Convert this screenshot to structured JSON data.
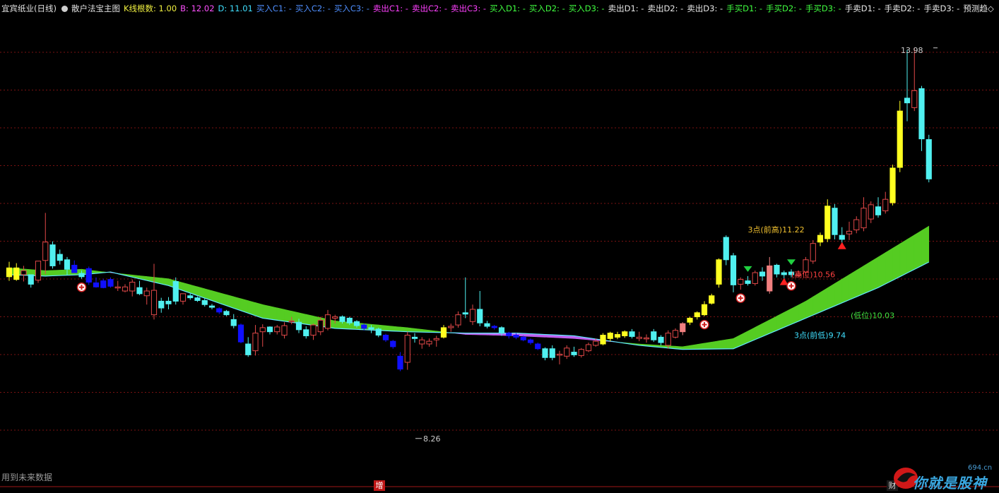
{
  "header": {
    "stock_title": "宜宾纸业(日线)",
    "indicator_name": "散户法宝主图",
    "items": [
      {
        "label": "K线根数: 1.00",
        "color": "#f0f040"
      },
      {
        "label": "B: 12.02",
        "color": "#ff50ff"
      },
      {
        "label": "D: 11.01",
        "color": "#40e0ff"
      },
      {
        "label": "买入C1: -",
        "color": "#4f8fff"
      },
      {
        "label": "买入C2: -",
        "color": "#4f8fff"
      },
      {
        "label": "买入C3: -",
        "color": "#4f8fff"
      },
      {
        "label": "卖出C1: -",
        "color": "#ff40ff"
      },
      {
        "label": "卖出C2: -",
        "color": "#ff40ff"
      },
      {
        "label": "卖出C3: -",
        "color": "#ff40ff"
      },
      {
        "label": "买入D1: -",
        "color": "#40ff40"
      },
      {
        "label": "买入D2: -",
        "color": "#40ff40"
      },
      {
        "label": "买入D3: -",
        "color": "#40ff40"
      },
      {
        "label": "卖出D1: -",
        "color": "#e8e8e8"
      },
      {
        "label": "卖出D2: -",
        "color": "#e8e8e8"
      },
      {
        "label": "卖出D3: -",
        "color": "#e8e8e8"
      },
      {
        "label": "手买D1: -",
        "color": "#40ff40"
      },
      {
        "label": "手买D2: -",
        "color": "#40ff40"
      },
      {
        "label": "手买D3: -",
        "color": "#40ff40"
      },
      {
        "label": "手卖D1: -",
        "color": "#e8e8e8"
      },
      {
        "label": "手卖D2: -",
        "color": "#e8e8e8"
      },
      {
        "label": "手卖D3: -",
        "color": "#e8e8e8"
      },
      {
        "label": "预测趋◇",
        "color": "#e8e8e8"
      }
    ]
  },
  "footer": {
    "note": "用到未来数据",
    "marker_zeng": "增",
    "marker_cai": "财",
    "watermark_site": "694.cn",
    "watermark_text": "你就是股神"
  },
  "colors": {
    "background": "#000000",
    "grid": "#7a1212",
    "up_candle": "#e04848",
    "down_candle": "#50f0f0",
    "yellow_candle": "#ffff20",
    "blue_candle": "#1010ff",
    "pink_candle": "#f08080",
    "band_green": "#55cc22",
    "band_purple": "#c060f0"
  },
  "chart_data": {
    "type": "candlestick",
    "ylim": [
      7.8,
      14.3
    ],
    "grid": "horizontal dotted",
    "candles": [
      {
        "o": 10.74,
        "h": 10.83,
        "l": 10.55,
        "c": 10.61,
        "k": "yellow"
      },
      {
        "o": 10.74,
        "h": 10.81,
        "l": 10.55,
        "c": 10.57,
        "k": "yellow"
      },
      {
        "o": 10.64,
        "h": 10.77,
        "l": 10.54,
        "c": 10.7,
        "k": "up"
      },
      {
        "o": 10.5,
        "h": 10.61,
        "l": 10.45,
        "c": 10.64,
        "k": "down"
      },
      {
        "o": 10.56,
        "h": 10.81,
        "l": 10.52,
        "c": 10.84,
        "k": "up"
      },
      {
        "o": 10.85,
        "h": 11.55,
        "l": 10.65,
        "c": 11.12,
        "k": "up"
      },
      {
        "o": 11.08,
        "h": 11.13,
        "l": 10.73,
        "c": 10.77,
        "k": "down"
      },
      {
        "o": 10.94,
        "h": 11.01,
        "l": 10.79,
        "c": 10.85,
        "k": "down"
      },
      {
        "o": 10.86,
        "h": 10.9,
        "l": 10.63,
        "c": 10.72,
        "k": "down"
      },
      {
        "o": 10.78,
        "h": 10.85,
        "l": 10.7,
        "c": 10.67,
        "k": "blue"
      },
      {
        "o": 10.66,
        "h": 10.7,
        "l": 10.58,
        "c": 10.61,
        "k": "down"
      },
      {
        "o": 10.73,
        "h": 10.76,
        "l": 10.49,
        "c": 10.53,
        "k": "blue"
      },
      {
        "o": 10.52,
        "h": 10.6,
        "l": 10.45,
        "c": 10.46,
        "k": "blue"
      },
      {
        "o": 10.55,
        "h": 10.58,
        "l": 10.44,
        "c": 10.45,
        "k": "blue"
      },
      {
        "o": 10.57,
        "h": 10.6,
        "l": 10.45,
        "c": 10.47,
        "k": "blue"
      },
      {
        "o": 10.46,
        "h": 10.55,
        "l": 10.4,
        "c": 10.46,
        "k": "up"
      },
      {
        "o": 10.4,
        "h": 10.5,
        "l": 10.38,
        "c": 10.46,
        "k": "up"
      },
      {
        "o": 10.4,
        "h": 10.57,
        "l": 10.32,
        "c": 10.53,
        "k": "up"
      },
      {
        "o": 10.45,
        "h": 10.55,
        "l": 10.34,
        "c": 10.36,
        "k": "down"
      },
      {
        "o": 10.33,
        "h": 10.45,
        "l": 10.2,
        "c": 10.4,
        "k": "up"
      },
      {
        "o": 10.05,
        "h": 10.8,
        "l": 9.98,
        "c": 10.41,
        "k": "up"
      },
      {
        "o": 10.15,
        "h": 10.3,
        "l": 10.08,
        "c": 10.25,
        "k": "down"
      },
      {
        "o": 10.25,
        "h": 10.31,
        "l": 10.13,
        "c": 10.21,
        "k": "down"
      },
      {
        "o": 10.54,
        "h": 10.6,
        "l": 10.2,
        "c": 10.25,
        "k": "down"
      },
      {
        "o": 10.25,
        "h": 10.36,
        "l": 10.2,
        "c": 10.36,
        "k": "up"
      },
      {
        "o": 10.3,
        "h": 10.36,
        "l": 10.27,
        "c": 10.33,
        "k": "down"
      },
      {
        "o": 10.3,
        "h": 10.32,
        "l": 10.24,
        "c": 10.26,
        "k": "down"
      },
      {
        "o": 10.26,
        "h": 10.29,
        "l": 10.17,
        "c": 10.2,
        "k": "down"
      },
      {
        "o": 10.18,
        "h": 10.21,
        "l": 10.13,
        "c": 10.16,
        "k": "down"
      },
      {
        "o": 10.14,
        "h": 10.16,
        "l": 10.06,
        "c": 10.09,
        "k": "blue"
      },
      {
        "o": 10.1,
        "h": 10.12,
        "l": 10.03,
        "c": 10.05,
        "k": "down"
      },
      {
        "o": 9.98,
        "h": 10.06,
        "l": 9.85,
        "c": 9.89,
        "k": "down"
      },
      {
        "o": 9.9,
        "h": 9.92,
        "l": 9.63,
        "c": 9.65,
        "k": "blue"
      },
      {
        "o": 9.62,
        "h": 9.72,
        "l": 9.43,
        "c": 9.46,
        "k": "down"
      },
      {
        "o": 9.52,
        "h": 9.9,
        "l": 9.45,
        "c": 9.78,
        "k": "up"
      },
      {
        "o": 9.8,
        "h": 9.91,
        "l": 9.58,
        "c": 9.86,
        "k": "up"
      },
      {
        "o": 9.87,
        "h": 9.88,
        "l": 9.76,
        "c": 9.8,
        "k": "down"
      },
      {
        "o": 9.8,
        "h": 9.9,
        "l": 9.76,
        "c": 9.87,
        "k": "up"
      },
      {
        "o": 9.75,
        "h": 9.94,
        "l": 9.7,
        "c": 9.89,
        "k": "up"
      },
      {
        "o": 9.96,
        "h": 10.02,
        "l": 9.91,
        "c": 9.95,
        "k": "up"
      },
      {
        "o": 9.94,
        "h": 9.99,
        "l": 9.78,
        "c": 9.83,
        "k": "down"
      },
      {
        "o": 9.83,
        "h": 9.88,
        "l": 9.7,
        "c": 9.74,
        "k": "down"
      },
      {
        "o": 9.75,
        "h": 9.92,
        "l": 9.68,
        "c": 9.9,
        "k": "up"
      },
      {
        "o": 9.8,
        "h": 10.02,
        "l": 9.75,
        "c": 9.97,
        "k": "up"
      },
      {
        "o": 9.85,
        "h": 10.12,
        "l": 9.82,
        "c": 10.05,
        "k": "up"
      },
      {
        "o": 10.0,
        "h": 10.05,
        "l": 9.92,
        "c": 10.02,
        "k": "up"
      },
      {
        "o": 10.02,
        "h": 10.04,
        "l": 9.92,
        "c": 9.95,
        "k": "down"
      },
      {
        "o": 10.0,
        "h": 10.02,
        "l": 9.9,
        "c": 9.93,
        "k": "down"
      },
      {
        "o": 9.95,
        "h": 9.97,
        "l": 9.86,
        "c": 9.89,
        "k": "down"
      },
      {
        "o": 9.9,
        "h": 9.92,
        "l": 9.82,
        "c": 9.85,
        "k": "blue"
      },
      {
        "o": 9.84,
        "h": 9.9,
        "l": 9.78,
        "c": 9.86,
        "k": "down"
      },
      {
        "o": 9.84,
        "h": 9.86,
        "l": 9.72,
        "c": 9.75,
        "k": "down"
      },
      {
        "o": 9.75,
        "h": 9.77,
        "l": 9.65,
        "c": 9.68,
        "k": "blue"
      },
      {
        "o": 9.66,
        "h": 9.68,
        "l": 9.55,
        "c": 9.58,
        "k": "blue"
      },
      {
        "o": 9.44,
        "h": 9.5,
        "l": 9.22,
        "c": 9.25,
        "k": "blue"
      },
      {
        "o": 9.35,
        "h": 9.8,
        "l": 9.24,
        "c": 9.75,
        "k": "up"
      },
      {
        "o": 9.72,
        "h": 9.78,
        "l": 9.64,
        "c": 9.7,
        "k": "down"
      },
      {
        "o": 9.62,
        "h": 9.72,
        "l": 9.55,
        "c": 9.68,
        "k": "up"
      },
      {
        "o": 9.62,
        "h": 9.7,
        "l": 9.58,
        "c": 9.66,
        "k": "up"
      },
      {
        "o": 9.68,
        "h": 9.74,
        "l": 9.58,
        "c": 9.7,
        "k": "up"
      },
      {
        "o": 9.72,
        "h": 9.9,
        "l": 9.7,
        "c": 9.86,
        "k": "yellow"
      },
      {
        "o": 9.86,
        "h": 9.92,
        "l": 9.8,
        "c": 9.88,
        "k": "up"
      },
      {
        "o": 9.9,
        "h": 10.1,
        "l": 9.86,
        "c": 10.05,
        "k": "up"
      },
      {
        "o": 10.06,
        "h": 10.6,
        "l": 10.0,
        "c": 10.08,
        "k": "down"
      },
      {
        "o": 9.95,
        "h": 10.2,
        "l": 9.9,
        "c": 10.13,
        "k": "up"
      },
      {
        "o": 10.13,
        "h": 10.4,
        "l": 9.88,
        "c": 9.93,
        "k": "down"
      },
      {
        "o": 9.92,
        "h": 9.96,
        "l": 9.85,
        "c": 9.88,
        "k": "down"
      },
      {
        "o": 9.88,
        "h": 9.9,
        "l": 9.83,
        "c": 9.86,
        "k": "blue"
      },
      {
        "o": 9.86,
        "h": 9.88,
        "l": 9.74,
        "c": 9.78,
        "k": "down"
      },
      {
        "o": 9.78,
        "h": 9.8,
        "l": 9.7,
        "c": 9.74,
        "k": "blue"
      },
      {
        "o": 9.75,
        "h": 9.78,
        "l": 9.69,
        "c": 9.72,
        "k": "blue"
      },
      {
        "o": 9.72,
        "h": 9.74,
        "l": 9.66,
        "c": 9.68,
        "k": "blue"
      },
      {
        "o": 9.68,
        "h": 9.7,
        "l": 9.61,
        "c": 9.64,
        "k": "blue"
      },
      {
        "o": 9.62,
        "h": 9.64,
        "l": 9.53,
        "c": 9.55,
        "k": "blue"
      },
      {
        "o": 9.55,
        "h": 9.57,
        "l": 9.38,
        "c": 9.42,
        "k": "down"
      },
      {
        "o": 9.42,
        "h": 9.6,
        "l": 9.38,
        "c": 9.55,
        "k": "down"
      },
      {
        "o": 9.46,
        "h": 9.52,
        "l": 9.32,
        "c": 9.47,
        "k": "up"
      },
      {
        "o": 9.44,
        "h": 9.6,
        "l": 9.4,
        "c": 9.56,
        "k": "up"
      },
      {
        "o": 9.5,
        "h": 9.58,
        "l": 9.43,
        "c": 9.46,
        "k": "down"
      },
      {
        "o": 9.45,
        "h": 9.56,
        "l": 9.42,
        "c": 9.54,
        "k": "up"
      },
      {
        "o": 9.52,
        "h": 9.64,
        "l": 9.5,
        "c": 9.61,
        "k": "up"
      },
      {
        "o": 9.6,
        "h": 9.7,
        "l": 9.58,
        "c": 9.66,
        "k": "up"
      },
      {
        "o": 9.62,
        "h": 9.78,
        "l": 9.6,
        "c": 9.75,
        "k": "yellow"
      },
      {
        "o": 9.7,
        "h": 9.8,
        "l": 9.66,
        "c": 9.78,
        "k": "yellow"
      },
      {
        "o": 9.72,
        "h": 9.8,
        "l": 9.69,
        "c": 9.76,
        "k": "yellow"
      },
      {
        "o": 9.74,
        "h": 9.82,
        "l": 9.71,
        "c": 9.8,
        "k": "yellow"
      },
      {
        "o": 9.8,
        "h": 9.84,
        "l": 9.7,
        "c": 9.73,
        "k": "down"
      },
      {
        "o": 9.7,
        "h": 9.8,
        "l": 9.66,
        "c": 9.72,
        "k": "up"
      },
      {
        "o": 9.7,
        "h": 9.76,
        "l": 9.64,
        "c": 9.71,
        "k": "up"
      },
      {
        "o": 9.8,
        "h": 9.84,
        "l": 9.65,
        "c": 9.68,
        "k": "down"
      },
      {
        "o": 9.72,
        "h": 9.75,
        "l": 9.6,
        "c": 9.64,
        "k": "down"
      },
      {
        "o": 9.6,
        "h": 9.82,
        "l": 9.55,
        "c": 9.78,
        "k": "up"
      },
      {
        "o": 9.72,
        "h": 9.85,
        "l": 9.7,
        "c": 9.82,
        "k": "up"
      },
      {
        "o": 9.8,
        "h": 9.94,
        "l": 9.75,
        "c": 9.92,
        "k": "pink"
      },
      {
        "o": 9.94,
        "h": 10.02,
        "l": 9.9,
        "c": 10.0,
        "k": "yellow"
      },
      {
        "o": 10.02,
        "h": 10.1,
        "l": 9.98,
        "c": 10.08,
        "k": "yellow"
      },
      {
        "o": 10.05,
        "h": 10.25,
        "l": 10.03,
        "c": 10.2,
        "k": "yellow"
      },
      {
        "o": 10.22,
        "h": 10.36,
        "l": 10.2,
        "c": 10.33,
        "k": "yellow"
      },
      {
        "o": 10.5,
        "h": 10.88,
        "l": 10.45,
        "c": 10.86,
        "k": "yellow"
      },
      {
        "o": 10.86,
        "h": 11.22,
        "l": 10.78,
        "c": 11.19,
        "k": "down"
      },
      {
        "o": 10.92,
        "h": 10.96,
        "l": 10.38,
        "c": 10.49,
        "k": "down"
      },
      {
        "o": 10.5,
        "h": 10.6,
        "l": 10.42,
        "c": 10.57,
        "k": "up"
      },
      {
        "o": 10.55,
        "h": 10.62,
        "l": 10.48,
        "c": 10.51,
        "k": "down"
      },
      {
        "o": 10.51,
        "h": 10.7,
        "l": 10.48,
        "c": 10.67,
        "k": "up"
      },
      {
        "o": 10.68,
        "h": 10.75,
        "l": 10.55,
        "c": 10.62,
        "k": "down"
      },
      {
        "o": 10.4,
        "h": 10.9,
        "l": 10.36,
        "c": 10.77,
        "k": "pink"
      },
      {
        "o": 10.78,
        "h": 10.8,
        "l": 10.6,
        "c": 10.65,
        "k": "down"
      },
      {
        "o": 10.64,
        "h": 10.7,
        "l": 10.57,
        "c": 10.67,
        "k": "down"
      },
      {
        "o": 10.64,
        "h": 10.72,
        "l": 10.6,
        "c": 10.68,
        "k": "down"
      },
      {
        "o": 10.63,
        "h": 10.7,
        "l": 10.6,
        "c": 10.65,
        "k": "up"
      },
      {
        "o": 10.68,
        "h": 10.9,
        "l": 10.62,
        "c": 10.86,
        "k": "up"
      },
      {
        "o": 10.84,
        "h": 11.15,
        "l": 10.8,
        "c": 11.1,
        "k": "up"
      },
      {
        "o": 11.12,
        "h": 11.26,
        "l": 11.06,
        "c": 11.22,
        "k": "yellow"
      },
      {
        "o": 11.17,
        "h": 11.75,
        "l": 11.12,
        "c": 11.65,
        "k": "yellow"
      },
      {
        "o": 11.62,
        "h": 11.68,
        "l": 11.16,
        "c": 11.23,
        "k": "down"
      },
      {
        "o": 11.22,
        "h": 11.34,
        "l": 11.1,
        "c": 11.16,
        "k": "down"
      },
      {
        "o": 11.28,
        "h": 11.42,
        "l": 11.15,
        "c": 11.24,
        "k": "up"
      },
      {
        "o": 11.3,
        "h": 11.5,
        "l": 11.25,
        "c": 11.45,
        "k": "up"
      },
      {
        "o": 11.33,
        "h": 11.78,
        "l": 11.28,
        "c": 11.62,
        "k": "up"
      },
      {
        "o": 11.46,
        "h": 11.72,
        "l": 11.4,
        "c": 11.67,
        "k": "up"
      },
      {
        "o": 11.52,
        "h": 11.78,
        "l": 11.48,
        "c": 11.64,
        "k": "down"
      },
      {
        "o": 11.58,
        "h": 11.86,
        "l": 11.54,
        "c": 11.75,
        "k": "up"
      },
      {
        "o": 11.7,
        "h": 12.26,
        "l": 11.66,
        "c": 12.21,
        "k": "yellow"
      },
      {
        "o": 12.22,
        "h": 13.2,
        "l": 12.15,
        "c": 13.05,
        "k": "yellow"
      },
      {
        "o": 13.17,
        "h": 13.95,
        "l": 12.9,
        "c": 13.24,
        "k": "down"
      },
      {
        "o": 13.1,
        "h": 13.98,
        "l": 13.05,
        "c": 13.35,
        "k": "up"
      },
      {
        "o": 13.38,
        "h": 13.42,
        "l": 12.46,
        "c": 12.64,
        "k": "down"
      },
      {
        "o": 12.63,
        "h": 12.7,
        "l": 12.0,
        "c": 12.05,
        "k": "down"
      }
    ],
    "band_green_upper": [
      [
        0,
        10.74
      ],
      [
        5,
        10.7
      ],
      [
        10,
        10.72
      ],
      [
        14,
        10.67
      ],
      [
        22,
        10.58
      ],
      [
        35,
        10.2
      ],
      [
        45,
        9.96
      ],
      [
        55,
        9.86
      ],
      [
        63,
        9.76
      ],
      [
        70,
        9.74
      ],
      [
        78,
        9.7
      ],
      [
        87,
        9.62
      ],
      [
        93,
        9.58
      ],
      [
        100,
        9.7
      ],
      [
        110,
        10.25
      ],
      [
        120,
        10.9
      ],
      [
        128,
        11.42
      ],
      [
        134,
        11.98
      ]
    ],
    "band_green_lower": [
      [
        0,
        10.64
      ],
      [
        5,
        10.62
      ],
      [
        10,
        10.64
      ],
      [
        14,
        10.68
      ],
      [
        22,
        10.48
      ],
      [
        35,
        10.0
      ],
      [
        45,
        9.85
      ],
      [
        55,
        9.8
      ],
      [
        63,
        9.78
      ],
      [
        70,
        9.78
      ],
      [
        78,
        9.74
      ],
      [
        87,
        9.6
      ],
      [
        93,
        9.54
      ],
      [
        100,
        9.55
      ],
      [
        110,
        10.0
      ],
      [
        120,
        10.45
      ],
      [
        128,
        10.88
      ],
      [
        134,
        11.48
      ]
    ],
    "annotations": [
      {
        "text": "13.98",
        "i": 128,
        "price": 13.98
      },
      {
        "text": "8.26",
        "i": 56,
        "price": 8.26
      },
      {
        "text": "3点(前高)11.22",
        "i": 102,
        "price": 11.22
      },
      {
        "text": "(高位)10.56",
        "i": 108,
        "price": 10.56
      },
      {
        "text": "(低位)10.03",
        "i": 116,
        "price": 10.03
      },
      {
        "text": "3点(前低)9.74",
        "i": 108,
        "price": 9.74
      }
    ],
    "sell_arrows": [
      102,
      108
    ],
    "buy_arrows": [
      107,
      115
    ],
    "buy_circles": [
      10,
      96,
      101,
      108
    ]
  }
}
